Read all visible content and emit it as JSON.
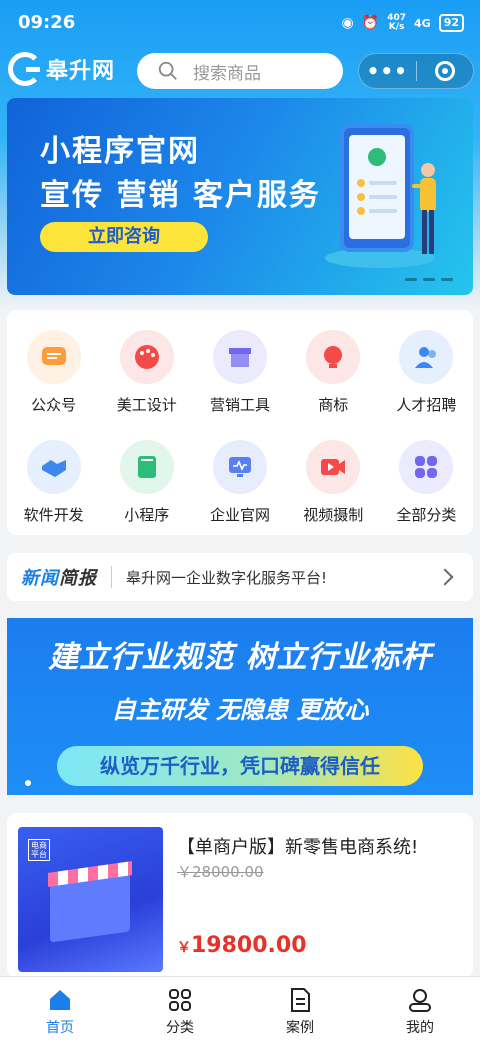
{
  "status_bar": {
    "time": "09:26",
    "net_speed_value": "407",
    "net_speed_unit": "K/s",
    "signal": "4G",
    "battery": "92"
  },
  "header": {
    "logo_text": "皋升网",
    "search_placeholder": "搜索商品",
    "capsule_more": "•••"
  },
  "banner_top": {
    "line1": "小程序官网",
    "line2": "宣传 营销 客户服务",
    "cta": "立即咨询"
  },
  "categories": [
    {
      "label": "公众号",
      "icon": "wechat-official-icon",
      "color": "#ff9b3a",
      "bg": "#fff1e3"
    },
    {
      "label": "美工设计",
      "icon": "palette-icon",
      "color": "#f44a4a",
      "bg": "#fde6e6"
    },
    {
      "label": "营销工具",
      "icon": "store-icon",
      "color": "#7366f0",
      "bg": "#ecebfd"
    },
    {
      "label": "商标",
      "icon": "bulb-icon",
      "color": "#f44a4a",
      "bg": "#fde6e6"
    },
    {
      "label": "人才招聘",
      "icon": "people-icon",
      "color": "#3a88f0",
      "bg": "#e6effd"
    },
    {
      "label": "软件开发",
      "icon": "handshake-icon",
      "color": "#3a88f0",
      "bg": "#e6effd"
    },
    {
      "label": "小程序",
      "icon": "book-icon",
      "color": "#2dbd78",
      "bg": "#e3f6ec"
    },
    {
      "label": "企业官网",
      "icon": "monitor-icon",
      "color": "#5a7ff0",
      "bg": "#e8edfd"
    },
    {
      "label": "视频摄制",
      "icon": "video-icon",
      "color": "#f44a4a",
      "bg": "#fde6e6"
    },
    {
      "label": "全部分类",
      "icon": "grid-icon",
      "color": "#7366f0",
      "bg": "#ecebfd"
    }
  ],
  "news": {
    "tag_a": "新闻",
    "tag_b": "简报",
    "text": "皋升网一企业数字化服务平台!"
  },
  "banner_mid": {
    "headline": "建立行业规范 树立行业标杆",
    "sub": "自主研发 无隐患 更放心",
    "pill": "纵览万千行业，凭口碑赢得信任"
  },
  "product": {
    "image_badge": "电商平台",
    "title": "【单商户版】新零售电商系统!",
    "old_price": "￥28000.00",
    "currency": "￥",
    "price": "19800.00"
  },
  "tabbar": [
    {
      "label": "首页",
      "icon": "home-icon",
      "active": true
    },
    {
      "label": "分类",
      "icon": "category-icon",
      "active": false
    },
    {
      "label": "案例",
      "icon": "document-icon",
      "active": false
    },
    {
      "label": "我的",
      "icon": "user-icon",
      "active": false
    }
  ],
  "colors": {
    "primary": "#1a7fe6",
    "price": "#e6322b",
    "cta_yellow": "#fde43a"
  }
}
